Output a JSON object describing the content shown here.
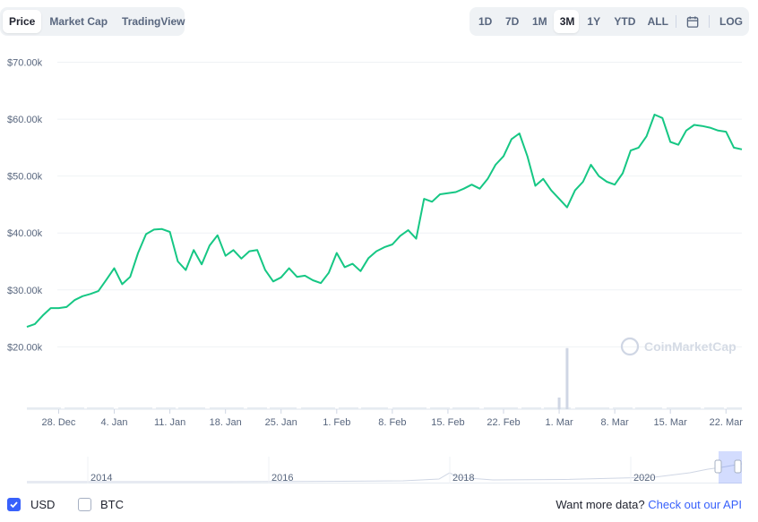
{
  "tabs": [
    "Price",
    "Market Cap",
    "TradingView"
  ],
  "active_tab": "Price",
  "ranges": [
    "1D",
    "7D",
    "1M",
    "3M",
    "1Y",
    "YTD",
    "ALL"
  ],
  "active_range": "3M",
  "log_label": "LOG",
  "watermark": "CoinMarketCap",
  "accent_color": "#16c784",
  "navigator": {
    "years": [
      "2014",
      "2016",
      "2018",
      "2020"
    ]
  },
  "footer": {
    "usd_label": "USD",
    "usd_checked": true,
    "btc_label": "BTC",
    "btc_checked": false,
    "more_text": "Want more data?",
    "api_link": "Check out our API"
  },
  "chart_data": {
    "type": "line",
    "xlabel": "",
    "ylabel": "",
    "grid": true,
    "y_tick_labels": [
      "$20.00k",
      "$30.00k",
      "$40.00k",
      "$50.00k",
      "$60.00k",
      "$70.00k"
    ],
    "y_ticks": [
      20000,
      30000,
      40000,
      50000,
      60000,
      70000
    ],
    "ylim": [
      18800,
      71500
    ],
    "x_tick_labels": [
      "28. Dec",
      "4. Jan",
      "11. Jan",
      "18. Jan",
      "25. Jan",
      "1. Feb",
      "8. Feb",
      "15. Feb",
      "22. Feb",
      "1. Mar",
      "8. Mar",
      "15. Mar",
      "22. Mar"
    ],
    "x_ticks": [
      "2020-12-28",
      "2021-01-04",
      "2021-01-11",
      "2021-01-18",
      "2021-01-25",
      "2021-02-01",
      "2021-02-08",
      "2021-02-15",
      "2021-02-22",
      "2021-03-01",
      "2021-03-08",
      "2021-03-15",
      "2021-03-22"
    ],
    "xlim": [
      "2020-12-24",
      "2021-03-24"
    ],
    "series": [
      {
        "color": "#16c784",
        "points": [
          [
            "2020-12-24",
            23500
          ],
          [
            "2020-12-25",
            24000
          ],
          [
            "2020-12-26",
            25500
          ],
          [
            "2020-12-27",
            26800
          ],
          [
            "2020-12-28",
            26800
          ],
          [
            "2020-12-29",
            27000
          ],
          [
            "2020-12-30",
            28200
          ],
          [
            "2020-12-31",
            28900
          ],
          [
            "2021-01-01",
            29300
          ],
          [
            "2021-01-02",
            29800
          ],
          [
            "2021-01-03",
            31800
          ],
          [
            "2021-01-04",
            33800
          ],
          [
            "2021-01-05",
            31000
          ],
          [
            "2021-01-06",
            32300
          ],
          [
            "2021-01-07",
            36500
          ],
          [
            "2021-01-08",
            39800
          ],
          [
            "2021-01-09",
            40600
          ],
          [
            "2021-01-10",
            40700
          ],
          [
            "2021-01-11",
            40200
          ],
          [
            "2021-01-12",
            35000
          ],
          [
            "2021-01-13",
            33500
          ],
          [
            "2021-01-14",
            37000
          ],
          [
            "2021-01-15",
            34500
          ],
          [
            "2021-01-16",
            37800
          ],
          [
            "2021-01-17",
            39600
          ],
          [
            "2021-01-18",
            36000
          ],
          [
            "2021-01-19",
            37000
          ],
          [
            "2021-01-20",
            35500
          ],
          [
            "2021-01-21",
            36800
          ],
          [
            "2021-01-22",
            37000
          ],
          [
            "2021-01-23",
            33500
          ],
          [
            "2021-01-24",
            31500
          ],
          [
            "2021-01-25",
            32200
          ],
          [
            "2021-01-26",
            33800
          ],
          [
            "2021-01-27",
            32300
          ],
          [
            "2021-01-28",
            32500
          ],
          [
            "2021-01-29",
            31700
          ],
          [
            "2021-01-30",
            31200
          ],
          [
            "2021-01-31",
            33000
          ],
          [
            "2021-02-01",
            36500
          ],
          [
            "2021-02-02",
            34000
          ],
          [
            "2021-02-03",
            34600
          ],
          [
            "2021-02-04",
            33300
          ],
          [
            "2021-02-05",
            35600
          ],
          [
            "2021-02-06",
            36800
          ],
          [
            "2021-02-07",
            37500
          ],
          [
            "2021-02-08",
            38000
          ],
          [
            "2021-02-09",
            39500
          ],
          [
            "2021-02-10",
            40500
          ],
          [
            "2021-02-11",
            39000
          ],
          [
            "2021-02-12",
            46000
          ],
          [
            "2021-02-13",
            45500
          ],
          [
            "2021-02-14",
            46800
          ],
          [
            "2021-02-15",
            47000
          ],
          [
            "2021-02-16",
            47200
          ],
          [
            "2021-02-17",
            47800
          ],
          [
            "2021-02-18",
            48500
          ],
          [
            "2021-02-19",
            47800
          ],
          [
            "2021-02-20",
            49500
          ],
          [
            "2021-02-21",
            52000
          ],
          [
            "2021-02-22",
            53500
          ],
          [
            "2021-02-23",
            56500
          ],
          [
            "2021-02-24",
            57500
          ],
          [
            "2021-02-25",
            53500
          ],
          [
            "2021-02-26",
            48300
          ],
          [
            "2021-02-27",
            49500
          ],
          [
            "2021-02-28",
            47500
          ],
          [
            "2021-03-01",
            46000
          ],
          [
            "2021-03-02",
            44500
          ],
          [
            "2021-03-03",
            47500
          ],
          [
            "2021-03-04",
            49000
          ],
          [
            "2021-03-05",
            52000
          ],
          [
            "2021-03-06",
            50000
          ],
          [
            "2021-03-07",
            49000
          ],
          [
            "2021-03-08",
            48500
          ],
          [
            "2021-03-09",
            50500
          ],
          [
            "2021-03-10",
            54500
          ],
          [
            "2021-03-11",
            55000
          ],
          [
            "2021-03-12",
            57000
          ],
          [
            "2021-03-13",
            60800
          ],
          [
            "2021-03-14",
            60200
          ],
          [
            "2021-03-15",
            56000
          ],
          [
            "2021-03-16",
            55500
          ],
          [
            "2021-03-17",
            58000
          ],
          [
            "2021-03-18",
            59000
          ],
          [
            "2021-03-19",
            58800
          ],
          [
            "2021-03-20",
            58500
          ],
          [
            "2021-03-21",
            58000
          ],
          [
            "2021-03-22",
            57800
          ],
          [
            "2021-03-23",
            55000
          ],
          [
            "2021-03-24",
            54700
          ]
        ]
      }
    ],
    "volume_bars": [
      [
        "2021-03-01",
        2
      ],
      [
        "2021-03-02",
        10.5
      ]
    ]
  }
}
